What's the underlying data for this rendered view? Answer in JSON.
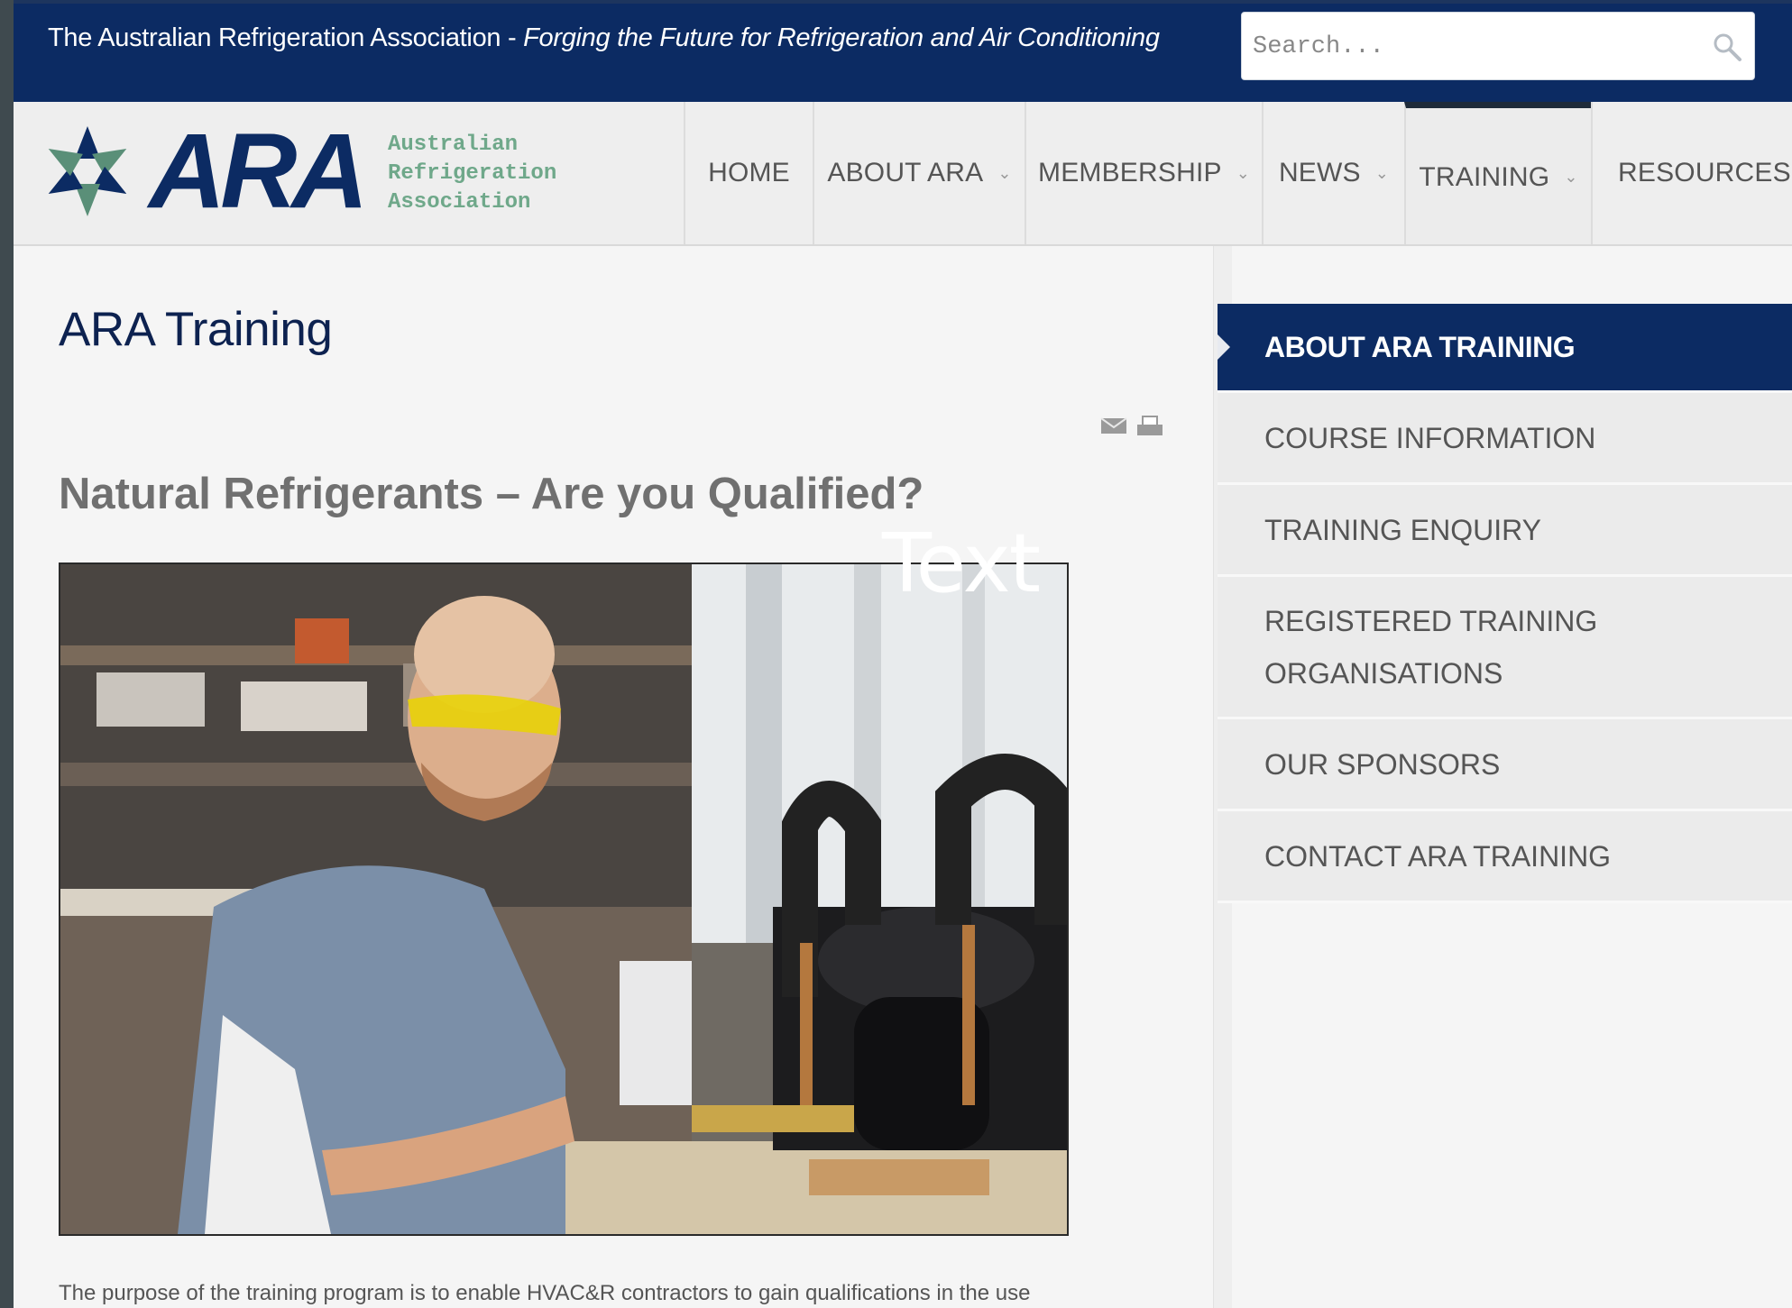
{
  "topbar": {
    "tagline_prefix": "The Australian Refrigeration Association - ",
    "tagline_italic": "Forging the Future for Refrigeration and Air Conditioning",
    "search_placeholder": "Search...",
    "background_color": "#0c2b63"
  },
  "logo": {
    "letters": "ARA",
    "line1": "Australian",
    "line2": "Refrigeration",
    "line3": "Association"
  },
  "nav": {
    "items": [
      {
        "label": "HOME",
        "has_dropdown": false
      },
      {
        "label": "ABOUT ARA",
        "has_dropdown": true
      },
      {
        "label": "MEMBERSHIP",
        "has_dropdown": true
      },
      {
        "label": "NEWS",
        "has_dropdown": true
      },
      {
        "label": "TRAINING",
        "has_dropdown": true,
        "active": true
      },
      {
        "label": "RESOURCES",
        "has_dropdown": true
      }
    ],
    "dropdown_glyph": "⌄"
  },
  "main": {
    "page_title": "ARA Training",
    "article_title": "Natural Refrigerants – Are you Qualified?",
    "overlay_text": "Text",
    "body_text": "The purpose of the training program is to enable HVAC&R contractors to gain qualifications in the use"
  },
  "sidebar": {
    "items": [
      {
        "label": "ABOUT ARA TRAINING",
        "active": true
      },
      {
        "label": "COURSE INFORMATION"
      },
      {
        "label": "TRAINING ENQUIRY"
      },
      {
        "label": "REGISTERED TRAINING ORGANISATIONS",
        "line1": "REGISTERED TRAINING",
        "line2": "ORGANISATIONS"
      },
      {
        "label": "OUR SPONSORS"
      },
      {
        "label": "CONTACT ARA TRAINING"
      }
    ]
  },
  "icons": {
    "search": "search-icon",
    "email": "email-icon",
    "print": "print-icon"
  }
}
